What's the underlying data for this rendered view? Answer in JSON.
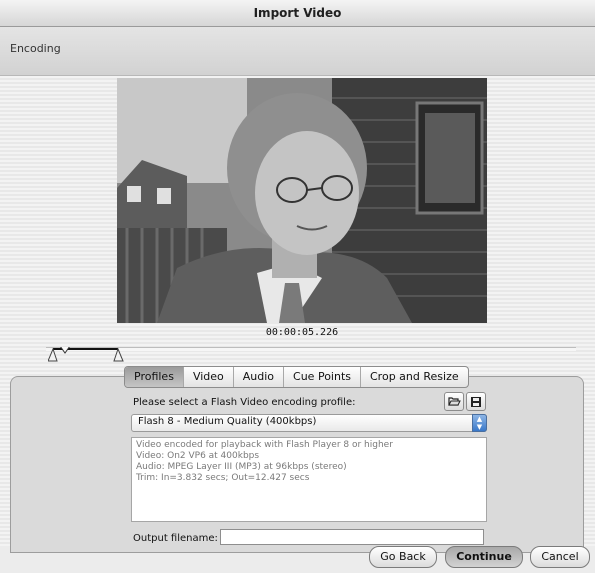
{
  "window": {
    "title": "Import Video"
  },
  "section": {
    "title": "Encoding"
  },
  "video": {
    "timecode": "00:00:05.226"
  },
  "tabs": [
    {
      "label": "Profiles",
      "active": true
    },
    {
      "label": "Video",
      "active": false
    },
    {
      "label": "Audio",
      "active": false
    },
    {
      "label": "Cue Points",
      "active": false
    },
    {
      "label": "Crop and Resize",
      "active": false
    }
  ],
  "profiles": {
    "select_label": "Please select a Flash Video encoding profile:",
    "selected_profile": "Flash 8 - Medium Quality (400kbps)",
    "description": [
      "Video encoded for playback with Flash Player 8 or higher",
      "Video: On2 VP6 at 400kbps",
      "Audio: MPEG Layer III (MP3) at 96kbps (stereo)",
      "Trim: In=3.832 secs; Out=12.427 secs"
    ],
    "icons": [
      "folder-open-icon",
      "save-icon"
    ]
  },
  "output": {
    "label": "Output filename:",
    "value": ""
  },
  "buttons": {
    "back": "Go Back",
    "continue": "Continue",
    "cancel": "Cancel"
  }
}
